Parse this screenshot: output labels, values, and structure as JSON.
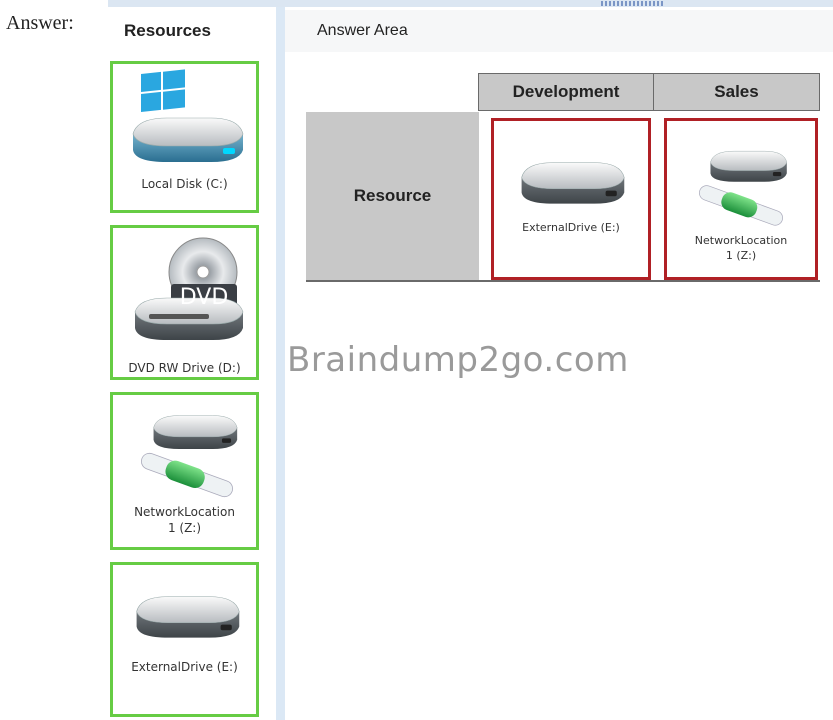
{
  "prefix": "Answer:",
  "resources": {
    "title": "Resources",
    "items": [
      {
        "label": "Local Disk (C:)",
        "icon": "local-disk-icon"
      },
      {
        "label": "DVD RW Drive (D:)",
        "icon": "dvd-drive-icon",
        "badge": "DVD"
      },
      {
        "label_line1": "NetworkLocation",
        "label_line2": "1 (Z:)",
        "icon": "network-location-icon"
      },
      {
        "label": "ExternalDrive (E:)",
        "icon": "external-drive-icon"
      }
    ]
  },
  "answer_area": {
    "title": "Answer Area",
    "columns": [
      "Development",
      "Sales"
    ],
    "row_header": "Resource",
    "cells": [
      {
        "column": "Development",
        "label": "ExternalDrive (E:)",
        "icon": "external-drive-icon"
      },
      {
        "column": "Sales",
        "label_line1": "NetworkLocation",
        "label_line2": "1 (Z:)",
        "icon": "network-location-icon"
      }
    ]
  },
  "watermark": "Braindump2go.com",
  "colors": {
    "tile_border": "#66cc44",
    "drop_border": "#b02025",
    "header_gray": "#c8c8c8",
    "splitter": "#dbe8f5"
  }
}
